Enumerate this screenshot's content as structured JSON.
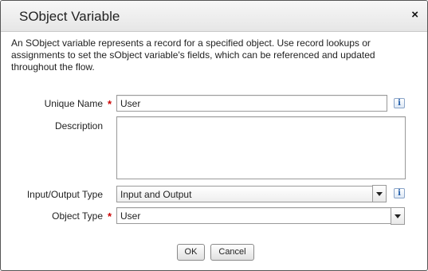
{
  "dialog": {
    "title": "SObject Variable",
    "close_symbol": "×",
    "description": "An SObject variable represents a record for a specified object. Use record lookups or assignments to set the sObject variable's fields, which can be referenced and updated throughout the flow."
  },
  "form": {
    "unique_name": {
      "label": "Unique Name",
      "value": "User",
      "required_marker": "*"
    },
    "description": {
      "label": "Description",
      "value": ""
    },
    "io_type": {
      "label": "Input/Output Type",
      "value": "Input and Output"
    },
    "object_type": {
      "label": "Object Type",
      "value": "User",
      "required_marker": "*"
    },
    "info_symbol": "i"
  },
  "buttons": {
    "ok_label": "OK",
    "cancel_label": "Cancel"
  },
  "icons": {
    "close": "close-icon",
    "info": "info-icon",
    "dropdown": "chevron-down-icon",
    "required": "required-asterisk-icon"
  }
}
